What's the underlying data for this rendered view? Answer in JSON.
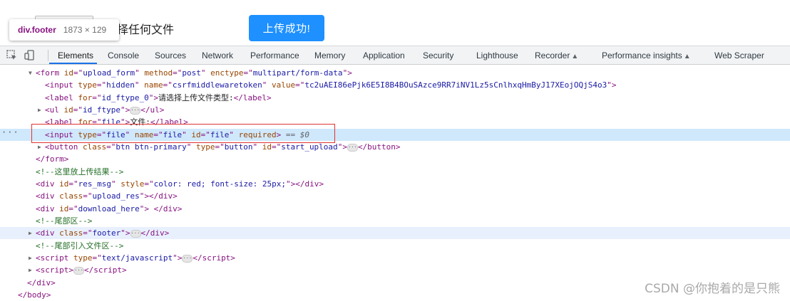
{
  "page": {
    "text_fragment": "择任何文件",
    "upload_success_button": "上传成功!",
    "tooltip": {
      "tag": "div.footer",
      "dims": "1873 × 129"
    }
  },
  "toolbar": {
    "tabs": [
      "Elements",
      "Console",
      "Sources",
      "Network",
      "Performance",
      "Memory",
      "Application",
      "Security",
      "Lighthouse",
      "Recorder",
      "Performance insights",
      "Web Scraper"
    ],
    "active_tab": "Elements",
    "accent": "#1a73e8"
  },
  "tree": {
    "form_open": {
      "tag": "form",
      "attrs": [
        [
          "id",
          "upload_form"
        ],
        [
          "method",
          "post"
        ],
        [
          "enctype",
          "multipart/form-data"
        ]
      ]
    },
    "input_hidden": {
      "tag": "input",
      "attrs": [
        [
          "type",
          "hidden"
        ],
        [
          "name",
          "csrfmiddlewaretoken"
        ],
        [
          "value",
          "tc2uAEI86ePjk6E5I8B4BOuSAzce9RR7iNV1Lz5sCnlhxqHmByJ17XEojOQjS4o3"
        ]
      ]
    },
    "label_type": {
      "tag": "label",
      "attrs": [
        [
          "for",
          "id_ftype_0"
        ]
      ],
      "text": "请选择上传文件类型:"
    },
    "ul": {
      "tag": "ul",
      "attrs": [
        [
          "id",
          "id_ftype"
        ]
      ]
    },
    "label_file": {
      "tag": "label",
      "attrs": [
        [
          "for",
          "file"
        ]
      ],
      "text": "文件:"
    },
    "input_file": {
      "tag": "input",
      "attrs": [
        [
          "type",
          "file"
        ],
        [
          "name",
          "file"
        ],
        [
          "id",
          "file"
        ]
      ],
      "flag": "required",
      "suffix": " == ",
      "dollar": "$0"
    },
    "button": {
      "tag": "button",
      "attrs": [
        [
          "class",
          "btn btn-primary"
        ],
        [
          "type",
          "button"
        ],
        [
          "id",
          "start_upload"
        ]
      ]
    },
    "form_close": "</form>",
    "comment_result": "<!--这里放上传结果-->",
    "res_msg": {
      "tag": "div",
      "attrs": [
        [
          "id",
          "res_msg"
        ],
        [
          "style",
          "color: red; font-size: 25px;"
        ]
      ]
    },
    "upload_res": {
      "tag": "div",
      "attrs": [
        [
          "class",
          "upload_res"
        ]
      ]
    },
    "download_here": {
      "tag": "div",
      "attrs": [
        [
          "id",
          "download_here"
        ]
      ]
    },
    "comment_tail": "<!--尾部区-->",
    "footer": {
      "tag": "div",
      "attrs": [
        [
          "class",
          "footer"
        ]
      ]
    },
    "comment_tail_js": "<!--尾部引入文件区-->",
    "script_js": {
      "tag": "script",
      "attrs": [
        [
          "type",
          "text/javascript"
        ]
      ]
    },
    "script_plain": {
      "tag": "script",
      "attrs": []
    },
    "div_close": "</div>",
    "body_close": "</body>"
  },
  "watermark": "CSDN @你抱着的是只熊"
}
